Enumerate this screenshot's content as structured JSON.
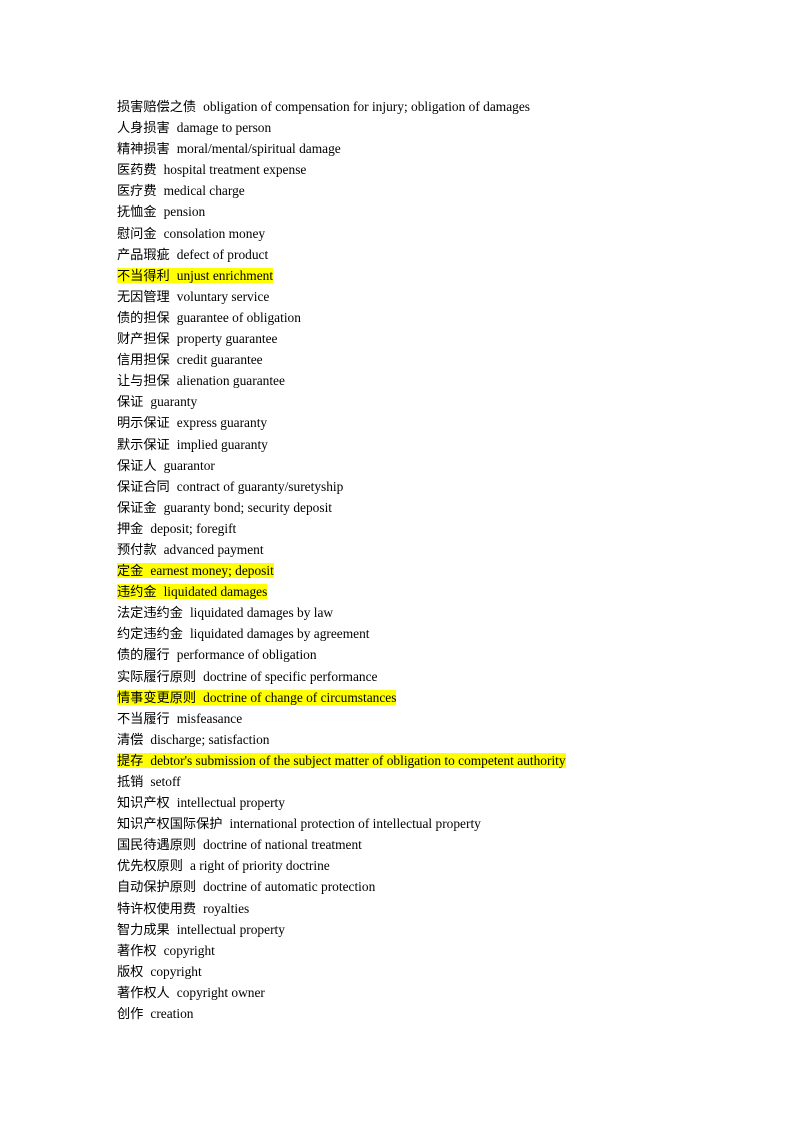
{
  "document": {
    "kind": "glossary",
    "page_background": "#ffffff",
    "text_color": "#000000",
    "highlight_color": "#ffff00",
    "entries": [
      {
        "term": "损害赔偿之债",
        "gloss": "obligation of compensation for injury; obligation of damages",
        "highlighted": false
      },
      {
        "term": "人身损害",
        "gloss": "damage to person",
        "highlighted": false
      },
      {
        "term": "精神损害",
        "gloss": "moral/mental/spiritual damage",
        "highlighted": false
      },
      {
        "term": "医药费",
        "gloss": "hospital treatment expense",
        "highlighted": false
      },
      {
        "term": "医疗费",
        "gloss": "medical charge",
        "highlighted": false
      },
      {
        "term": "抚恤金",
        "gloss": "pension",
        "highlighted": false
      },
      {
        "term": "慰问金",
        "gloss": "consolation money",
        "highlighted": false
      },
      {
        "term": "产品瑕疵",
        "gloss": "defect of product",
        "highlighted": false
      },
      {
        "term": "不当得利",
        "gloss": "unjust enrichment",
        "highlighted": true
      },
      {
        "term": "无因管理",
        "gloss": "voluntary service",
        "highlighted": false
      },
      {
        "term": "债的担保",
        "gloss": "guarantee of obligation",
        "highlighted": false
      },
      {
        "term": "财产担保",
        "gloss": "property guarantee",
        "highlighted": false
      },
      {
        "term": "信用担保",
        "gloss": "credit guarantee",
        "highlighted": false
      },
      {
        "term": "让与担保",
        "gloss": "alienation guarantee",
        "highlighted": false
      },
      {
        "term": "保证",
        "gloss": "guaranty",
        "highlighted": false
      },
      {
        "term": "明示保证",
        "gloss": "express guaranty",
        "highlighted": false
      },
      {
        "term": "默示保证",
        "gloss": "implied guaranty",
        "highlighted": false
      },
      {
        "term": "保证人",
        "gloss": "guarantor",
        "highlighted": false
      },
      {
        "term": "保证合同",
        "gloss": "contract of guaranty/suretyship",
        "highlighted": false
      },
      {
        "term": "保证金",
        "gloss": "guaranty bond; security deposit",
        "highlighted": false
      },
      {
        "term": "押金",
        "gloss": "deposit; foregift",
        "highlighted": false
      },
      {
        "term": "预付款",
        "gloss": "advanced payment",
        "highlighted": false
      },
      {
        "term": "定金",
        "gloss": "earnest money; deposit",
        "highlighted": true
      },
      {
        "term": "违约金",
        "gloss": "liquidated damages",
        "highlighted": true
      },
      {
        "term": "法定违约金",
        "gloss": "liquidated damages by law",
        "highlighted": false
      },
      {
        "term": "约定违约金",
        "gloss": "liquidated damages by agreement",
        "highlighted": false
      },
      {
        "term": "债的履行",
        "gloss": "performance of obligation",
        "highlighted": false
      },
      {
        "term": "实际履行原则",
        "gloss": "doctrine of specific performance",
        "highlighted": false
      },
      {
        "term": "情事变更原则",
        "gloss": "doctrine of change of circumstances",
        "highlighted": true
      },
      {
        "term": "不当履行",
        "gloss": "misfeasance",
        "highlighted": false
      },
      {
        "term": "清偿",
        "gloss": "discharge; satisfaction",
        "highlighted": false
      },
      {
        "term": "提存",
        "gloss": "debtor's submission of the subject matter of obligation to competent authority",
        "highlighted": true
      },
      {
        "term": "抵销",
        "gloss": "setoff",
        "highlighted": false
      },
      {
        "term": "知识产权",
        "gloss": "intellectual property",
        "highlighted": false
      },
      {
        "term": "知识产权国际保护",
        "gloss": "international protection of intellectual property",
        "highlighted": false
      },
      {
        "term": "国民待遇原则",
        "gloss": "doctrine of national treatment",
        "highlighted": false
      },
      {
        "term": "优先权原则",
        "gloss": "a right of priority doctrine",
        "highlighted": false
      },
      {
        "term": "自动保护原则",
        "gloss": "doctrine of automatic protection",
        "highlighted": false
      },
      {
        "term": "特许权使用费",
        "gloss": "royalties",
        "highlighted": false
      },
      {
        "term": "智力成果",
        "gloss": "intellectual property",
        "highlighted": false
      },
      {
        "term": "著作权",
        "gloss": "copyright",
        "highlighted": false
      },
      {
        "term": "版权",
        "gloss": "copyright",
        "highlighted": false
      },
      {
        "term": "著作权人",
        "gloss": "copyright owner",
        "highlighted": false
      },
      {
        "term": "创作",
        "gloss": "creation",
        "highlighted": false
      }
    ]
  }
}
